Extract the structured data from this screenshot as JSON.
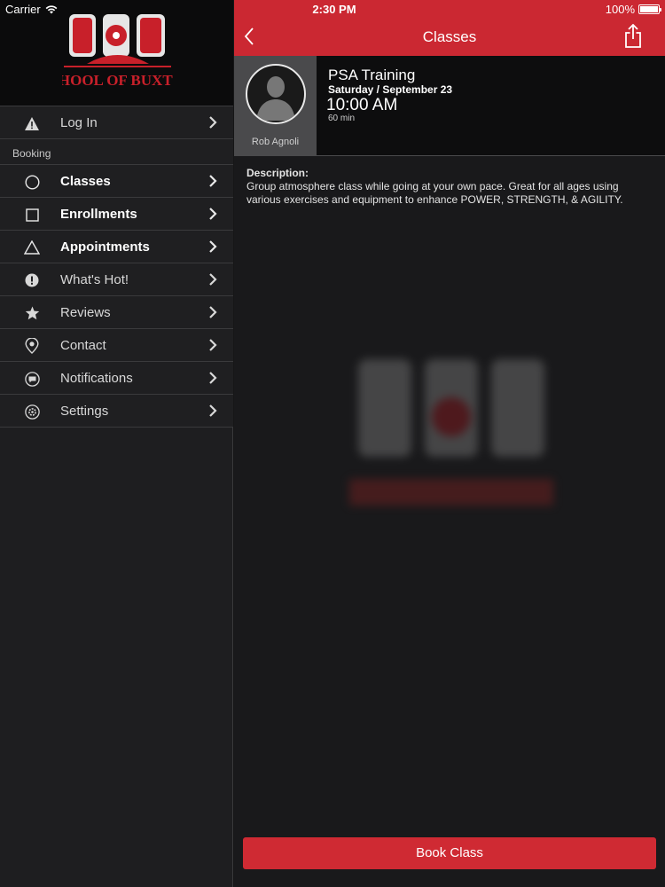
{
  "status_bar": {
    "carrier": "Carrier",
    "time": "2:30 PM",
    "battery": "100%"
  },
  "sidebar": {
    "logo_text": {
      "monogram": "S0B",
      "name": "SCHOOL OF BUXTON"
    },
    "login_label": "Log In",
    "section_label": "Booking",
    "items": [
      {
        "label": "Classes",
        "icon": "circle-icon",
        "bold": true
      },
      {
        "label": "Enrollments",
        "icon": "square-icon",
        "bold": true
      },
      {
        "label": "Appointments",
        "icon": "triangle-icon",
        "bold": true
      },
      {
        "label": "What's Hot!",
        "icon": "exclamation-icon",
        "bold": false
      },
      {
        "label": "Reviews",
        "icon": "star-icon",
        "bold": false
      },
      {
        "label": "Contact",
        "icon": "location-pin-icon",
        "bold": false
      },
      {
        "label": "Notifications",
        "icon": "chat-bubble-icon",
        "bold": false
      },
      {
        "label": "Settings",
        "icon": "gear-icon",
        "bold": false
      }
    ]
  },
  "navbar": {
    "title": "Classes",
    "back_icon": "chevron-left-icon",
    "share_icon": "share-icon"
  },
  "class_detail": {
    "instructor": "Rob Agnoli",
    "name": "PSA Training",
    "date": "Saturday / September 23",
    "time": "10:00 AM",
    "duration": "60 min",
    "description_label": "Description:",
    "description": "Group atmosphere class while going at your own pace. Great for all ages using various exercises and equipment to enhance POWER, STRENGTH, & AGILITY."
  },
  "book_button": "Book Class",
  "colors": {
    "accent": "#cb2832",
    "sidebar_bg": "#1f1f21",
    "main_bg": "#19191b"
  }
}
